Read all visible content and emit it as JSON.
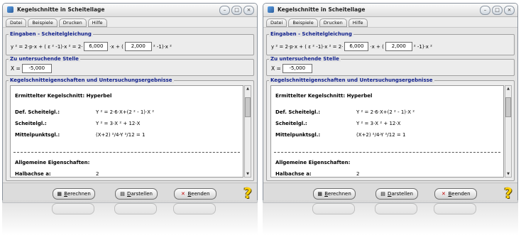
{
  "window": {
    "title": "Kegelschnitte in Scheitellage"
  },
  "menu": [
    "Datei",
    "Beispiele",
    "Drucken",
    "Hilfe"
  ],
  "equation_panel": {
    "label": "Eingaben - Scheitelgleichung",
    "prefix": "y ² = 2·p·x + ( ε ² -1)·x ² = 2·",
    "mid1": "·x + (",
    "mid2": "² -1)·x ²",
    "p_value": "6,000",
    "epsilon_value": "2,000"
  },
  "stelle_panel": {
    "label": "Zu untersuchende Stelle",
    "x_label": "X =",
    "x_value": "-5,000"
  },
  "results_panel": {
    "label": "Kegelschnitteigenschaften und Untersuchungsergebnisse",
    "kegelschnitt": "Ermittelter Kegelschnitt: Hyperbel",
    "lines": [
      {
        "key": "Def. Scheitelgl.:",
        "value": "Y ² = 2·6·X+(2 ² - 1)·X ²"
      },
      {
        "key": "Scheitelgl.:",
        "value": "Y ² = 3·X ² + 12·X"
      },
      {
        "key": "Mittelpunktsgl.:",
        "value": "(X+2) ²/4-Y ²/12 = 1"
      }
    ],
    "allgemein": "Allgemeine Eigenschaften:",
    "halbachse_label": "Halbachse a:",
    "halbachse_value": "2"
  },
  "buttons": {
    "berechnen": {
      "first": "B",
      "rest": "erechnen"
    },
    "darstellen": {
      "first": "D",
      "rest": "arstellen"
    },
    "beenden": {
      "first": "B",
      "rest": "eenden"
    }
  },
  "icons": {
    "app": "app-icon",
    "calculator": "calculator-icon",
    "chart": "chart-icon",
    "close_x": "close-x-icon",
    "help": "help-question-icon"
  },
  "colors": {
    "panel_label": "#10208c",
    "help_icon": "#ffd000",
    "beenden_x": "#c00000"
  }
}
